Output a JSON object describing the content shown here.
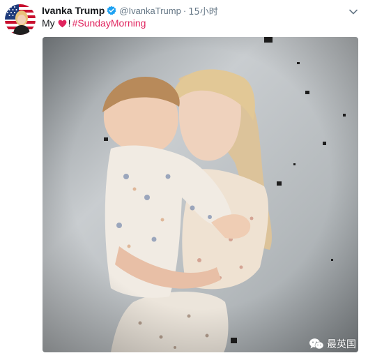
{
  "tweet": {
    "display_name": "Ivanka Trump",
    "handle": "@IvankaTrump",
    "separator": "·",
    "time": "15小时",
    "text_word": "My",
    "text_exclaim": "!",
    "hashtag": "#SundayMorning",
    "hashtag_color": "#e0245e",
    "verified_color": "#1da1f2"
  },
  "media": {
    "watermark_text": "最英国"
  },
  "icons": {
    "verified": "verified-badge-icon",
    "heart": "red-heart-icon",
    "caret": "chevron-down-icon",
    "watermark": "wechat-icon"
  }
}
